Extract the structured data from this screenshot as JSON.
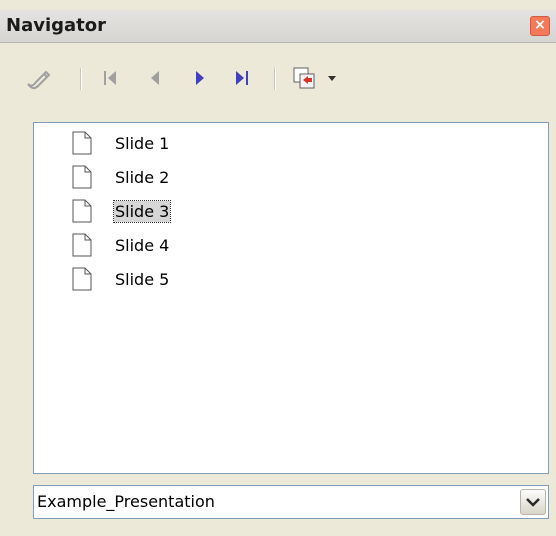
{
  "window": {
    "title": "Navigator",
    "close_label": "×"
  },
  "toolbar": {
    "buttons": [
      {
        "name": "pointer-tool",
        "icon": "pen-icon",
        "enabled": false
      },
      {
        "name": "first-slide",
        "icon": "first-slide-icon",
        "enabled": false
      },
      {
        "name": "previous-slide",
        "icon": "previous-slide-icon",
        "enabled": false
      },
      {
        "name": "next-slide",
        "icon": "next-slide-icon",
        "enabled": true
      },
      {
        "name": "last-slide",
        "icon": "last-slide-icon",
        "enabled": true
      },
      {
        "name": "drag-mode",
        "icon": "drag-mode-icon",
        "enabled": true
      }
    ]
  },
  "slides": {
    "items": [
      {
        "label": "Slide 1"
      },
      {
        "label": "Slide 2"
      },
      {
        "label": "Slide 3",
        "selected": true
      },
      {
        "label": "Slide 4"
      },
      {
        "label": "Slide 5"
      }
    ]
  },
  "document_select": {
    "value": "Example_Presentation"
  },
  "colors": {
    "accent": "#4040c0",
    "disabled": "#a0a0a0",
    "close": "#f27a5b"
  }
}
